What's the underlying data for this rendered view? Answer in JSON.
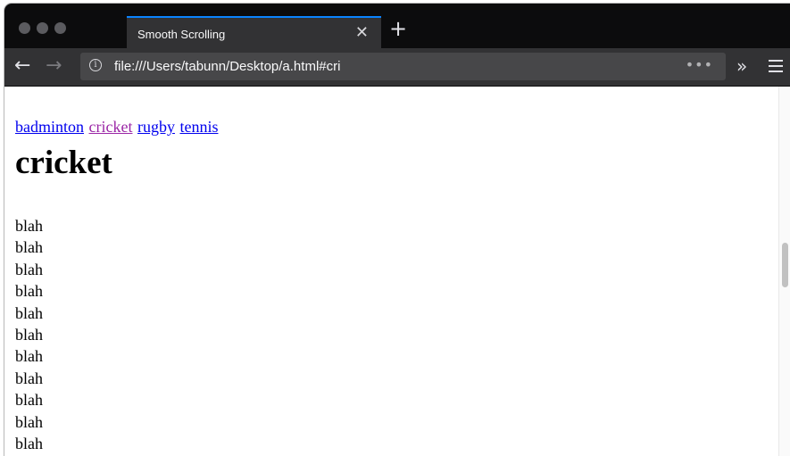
{
  "window": {
    "tab_title": "Smooth Scrolling",
    "tab_close": "✕",
    "new_tab": "+",
    "url": "file:///Users/tabunn/Desktop/a.html#cri",
    "info_glyph": "i",
    "page_actions": "•••",
    "overflow": "»",
    "back": "←",
    "forward": "→",
    "traffic_color": "#5b5b5f",
    "accent": "#0a84ff"
  },
  "page": {
    "links": [
      {
        "label": "badminton",
        "visited": false
      },
      {
        "label": "cricket",
        "visited": true
      },
      {
        "label": "rugby",
        "visited": false
      },
      {
        "label": "tennis",
        "visited": false
      }
    ],
    "heading": "cricket",
    "lines": [
      "blah",
      "blah",
      "blah",
      "blah",
      "blah",
      "blah",
      "blah",
      "blah",
      "blah",
      "blah",
      "blah",
      "blah"
    ],
    "link_color": "#0000ee",
    "visited_color": "#9b26a6"
  }
}
